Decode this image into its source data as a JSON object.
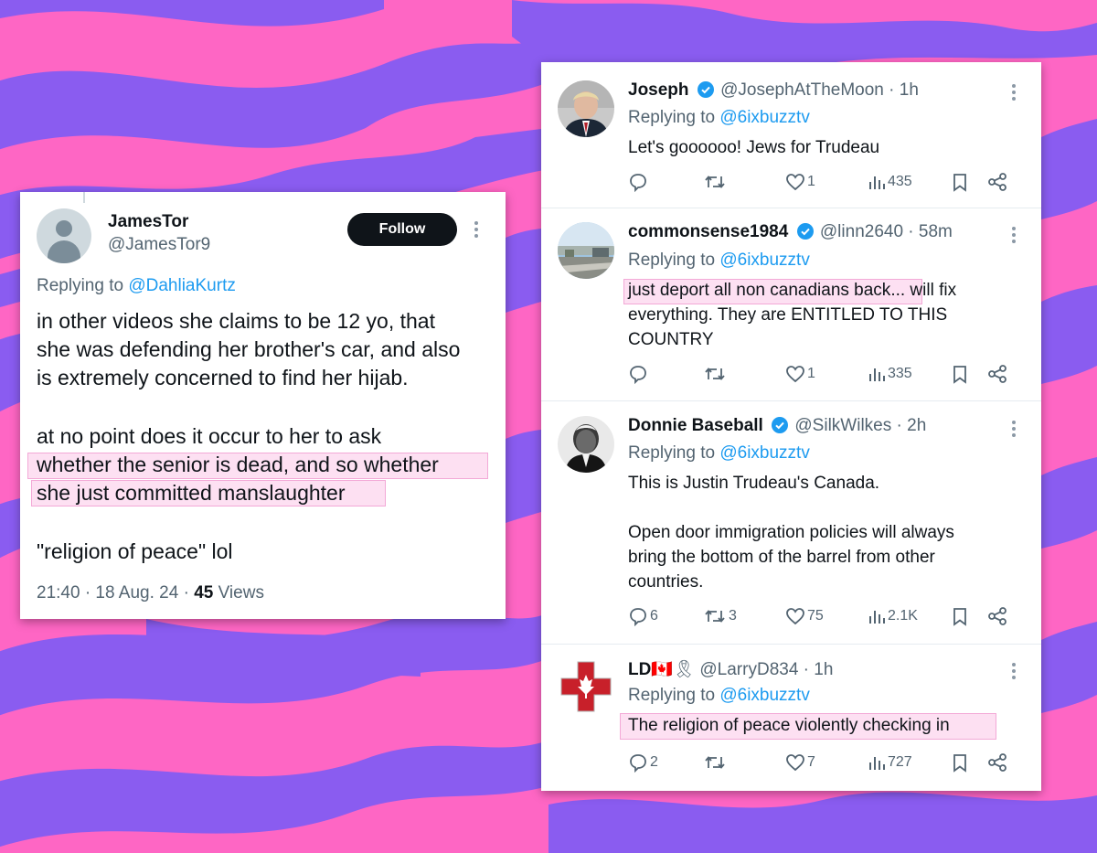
{
  "colors": {
    "bg_pink": "#fe66c4",
    "bg_purple": "#8a5cf0",
    "link": "#1d9bf0",
    "highlight": "#fde0f2",
    "verified": "#1d9bf0"
  },
  "left_post": {
    "name": "JamesTor",
    "handle": "@JamesTor9",
    "follow_label": "Follow",
    "replying_prefix": "Replying to",
    "replying_to": "@DahliaKurtz",
    "lines": [
      "in other videos she claims to be 12 yo, that",
      "she was defending her brother's car, and also",
      "is extremely concerned to find her hijab.",
      "at no point does it occur to her to ask",
      "whether the senior is dead, and so whether",
      "she just committed manslaughter",
      "\"religion of peace\" lol"
    ],
    "time": "21:40 · 18 Aug. 24 · ",
    "views_count": "45",
    "views_label": " Views"
  },
  "replies": [
    {
      "name": "Joseph",
      "verified": true,
      "handle": "@JosephAtTheMoon",
      "time": " · 1h",
      "replying_prefix": "Replying to",
      "replying_to": "@6ixbuzztv",
      "lines": [
        "Let's goooooo! Jews for Trudeau"
      ],
      "replies_count": "",
      "reposts_count": "",
      "likes_count": "1",
      "views_count": "435"
    },
    {
      "name": "commonsense1984",
      "verified": true,
      "handle": "@linn2640",
      "time": " · 58m",
      "replying_prefix": "Replying to",
      "replying_to": "@6ixbuzztv",
      "highlight": "just deport all non canadians back",
      "lines": [
        "... will fix",
        "everything. They are ENTITLED TO THIS",
        "COUNTRY"
      ],
      "replies_count": "",
      "reposts_count": "",
      "likes_count": "1",
      "views_count": "335"
    },
    {
      "name": "Donnie Baseball",
      "verified": true,
      "handle": "@SilkWilkes",
      "time": " · 2h",
      "replying_prefix": "Replying to",
      "replying_to": "@6ixbuzztv",
      "lines": [
        "This is Justin Trudeau's Canada.",
        "Open door immigration policies will always",
        "bring the bottom of the barrel from other",
        "countries."
      ],
      "replies_count": "6",
      "reposts_count": "3",
      "likes_count": "75",
      "views_count": "2.1K"
    },
    {
      "name": "LD",
      "name_emoji": "🇨🇦🎗",
      "verified": false,
      "handle": "@LarryD834",
      "time": " · 1h",
      "replying_prefix": "Replying to",
      "replying_to": "@6ixbuzztv",
      "lines": [
        "The religion of peace violently checking in"
      ],
      "replies_count": "2",
      "reposts_count": "",
      "likes_count": "7",
      "views_count": "727"
    }
  ]
}
